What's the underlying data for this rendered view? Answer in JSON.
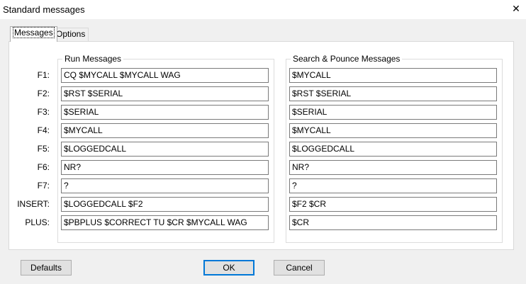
{
  "window": {
    "title": "Standard messages",
    "close_glyph": "✕"
  },
  "tabs": [
    {
      "label": "Messages",
      "active": true
    },
    {
      "label": "Options",
      "active": false
    }
  ],
  "run_group": {
    "title": "Run Messages"
  },
  "sp_group": {
    "title": "Search & Pounce Messages"
  },
  "rows": [
    {
      "key": "F1:",
      "run": "CQ $MYCALL $MYCALL WAG",
      "sp": "$MYCALL"
    },
    {
      "key": "F2:",
      "run": "$RST $SERIAL",
      "sp": "$RST $SERIAL"
    },
    {
      "key": "F3:",
      "run": "$SERIAL",
      "sp": "$SERIAL"
    },
    {
      "key": "F4:",
      "run": "$MYCALL",
      "sp": "$MYCALL"
    },
    {
      "key": "F5:",
      "run": "$LOGGEDCALL",
      "sp": "$LOGGEDCALL"
    },
    {
      "key": "F6:",
      "run": "NR?",
      "sp": "NR?"
    },
    {
      "key": "F7:",
      "run": "?",
      "sp": "?"
    },
    {
      "key": "INSERT:",
      "run": "$LOGGEDCALL $F2",
      "sp": "$F2 $CR"
    },
    {
      "key": "PLUS:",
      "run": "$PBPLUS $CORRECT TU $CR $MYCALL WAG",
      "sp": "$CR"
    }
  ],
  "buttons": {
    "defaults": "Defaults",
    "ok": "OK",
    "cancel": "Cancel"
  },
  "colors": {
    "focus_border": "#0078d7",
    "panel": "#ffffff",
    "window": "#f0f0f0"
  }
}
